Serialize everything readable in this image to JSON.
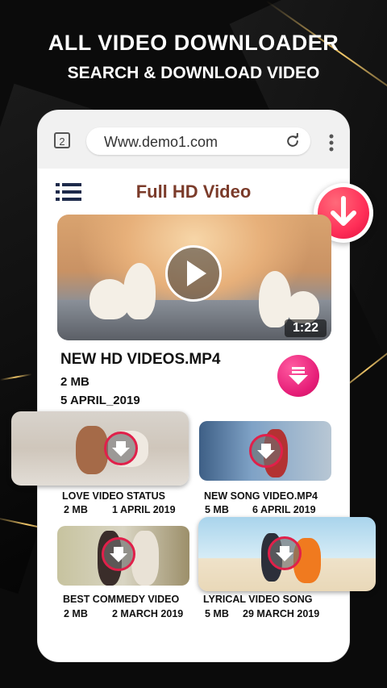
{
  "hero": {
    "title": "ALL VIDEO DOWNLOADER",
    "subtitle": "SEARCH & DOWNLOAD VIDEO"
  },
  "browser": {
    "tab_count": "2",
    "url": "Www.demo1.com"
  },
  "page": {
    "title": "Full HD Video"
  },
  "featured": {
    "duration": "1:22",
    "name": "NEW HD VIDEOS.MP4",
    "size": "2 MB",
    "date": "5 APRIL_2019"
  },
  "videos": [
    {
      "title": "LOVE VIDEO STATUS",
      "size": "2 MB",
      "date": "1 APRIL 2019"
    },
    {
      "title": "NEW SONG VIDEO.MP4",
      "size": "5 MB",
      "date": "6 APRIL 2019"
    },
    {
      "title": "BEST COMMEDY VIDEO",
      "size": "2 MB",
      "date": "2 MARCH 2019"
    },
    {
      "title": "LYRICAL VIDEO SONG",
      "size": "5 MB",
      "date": "29 MARCH 2019"
    }
  ],
  "colors": {
    "accent_red": "#ff2f58",
    "accent_pink": "#e61e78",
    "title_brown": "#7b3b2a",
    "background": "#0b0b0b"
  }
}
